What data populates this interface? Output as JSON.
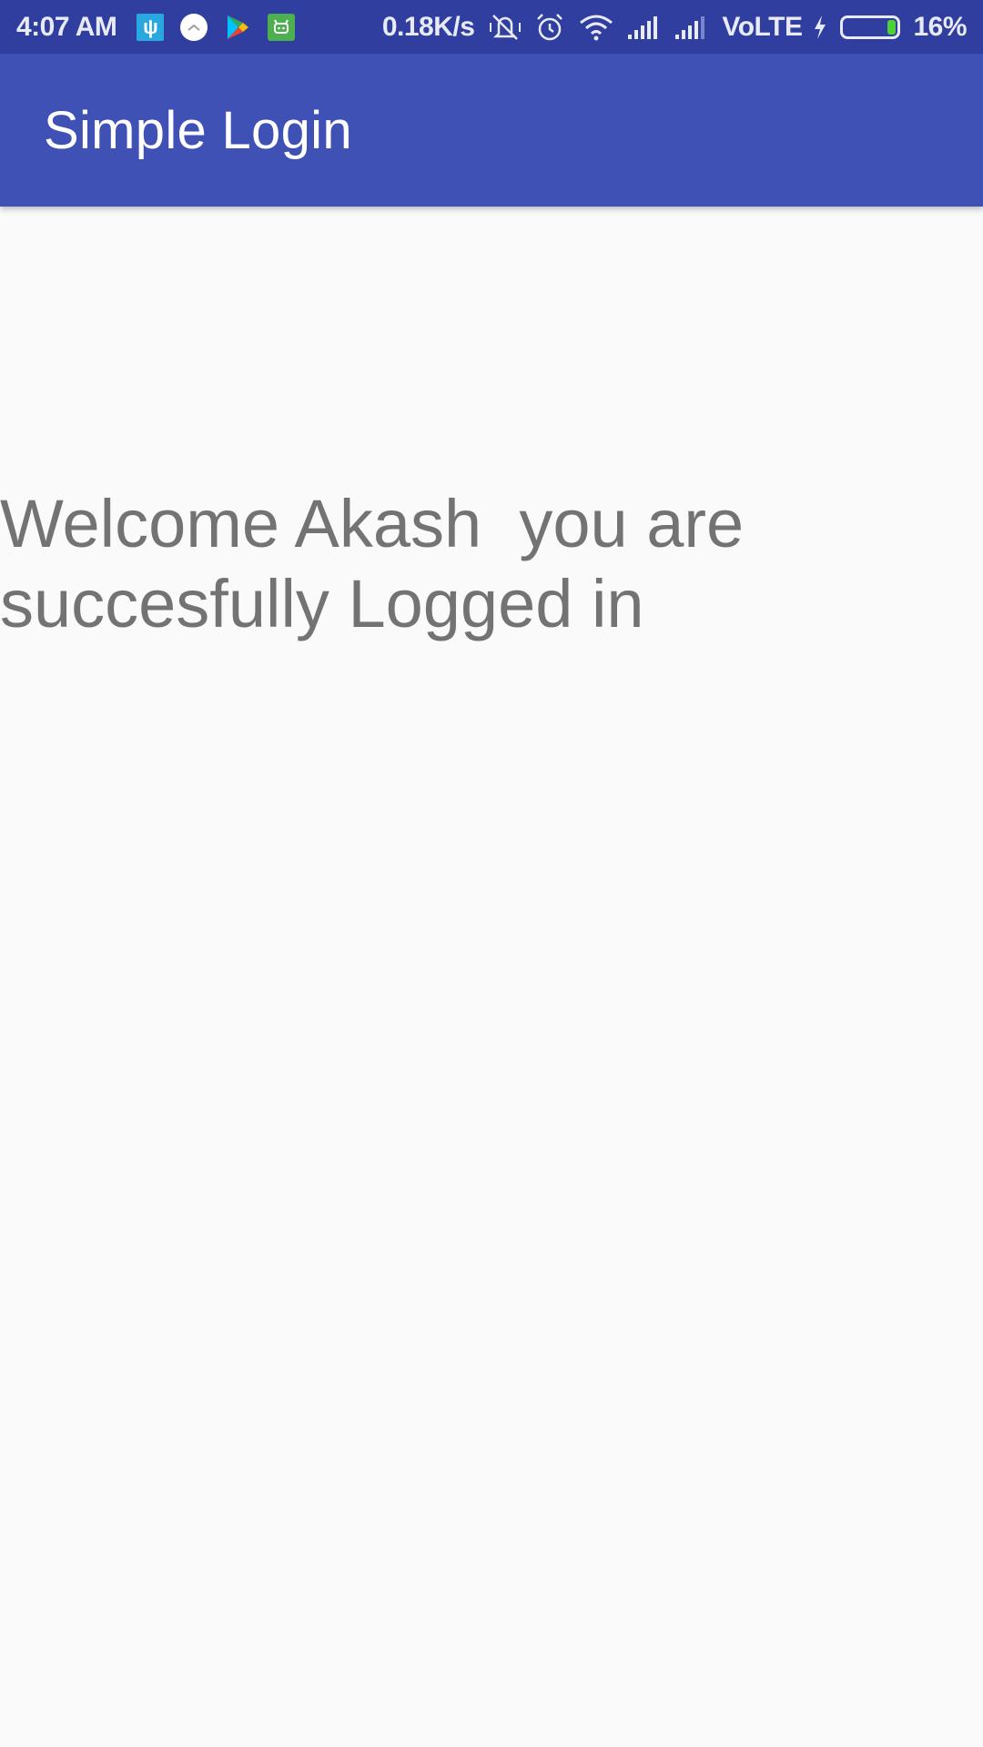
{
  "status_bar": {
    "time": "4:07 AM",
    "net_speed": "0.18K/s",
    "network": "VoLTE",
    "battery_percent": "16%",
    "battery_level": 0.16,
    "notification_icons": [
      "usb-icon",
      "circle-app-icon",
      "play-store-icon",
      "android-app-icon"
    ],
    "system_icons": [
      "vibrate-off-icon",
      "alarm-icon",
      "wifi-icon",
      "signal-icon",
      "signal-icon",
      "charging-icon",
      "battery-icon"
    ]
  },
  "app_bar": {
    "title": "Simple Login",
    "color": "#3f51b5"
  },
  "content": {
    "welcome_message": "Welcome Akash  you are succesfully Logged in"
  },
  "colors": {
    "status_bar": "#303f9f",
    "background": "#fafafa",
    "text": "#737373"
  }
}
